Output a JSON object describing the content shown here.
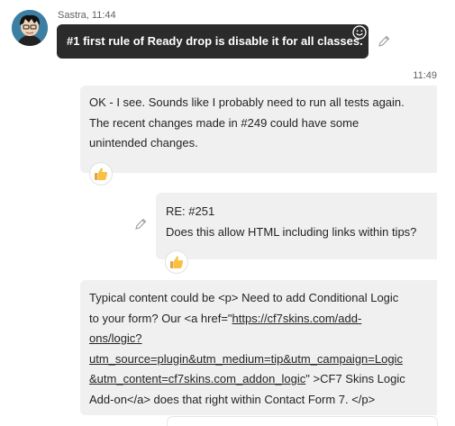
{
  "incoming": {
    "sender": "Sastra",
    "time": "11:44",
    "text": "#1 first rule of Ready drop is disable it for all classes."
  },
  "outgoing": {
    "time": "11:49",
    "messages": [
      {
        "lines": [
          "OK - I see. Sounds like I probably need to run all tests again.",
          "The recent changes made in #249 could have some",
          "unintended changes."
        ],
        "reaction": "thumbs-up"
      },
      {
        "lines": [
          "RE: #251",
          "Does this allow HTML including links within tips?"
        ],
        "reaction": "thumbs-up"
      },
      {
        "line1": "Typical content could be <p> Need to add Conditional Logic",
        "line2": "to your form? Our <a href=\"",
        "link1": "https://cf7skins.com/add-",
        "link2": "ons/logic?",
        "link3": "utm_source=plugin&utm_medium=tip&utm_campaign=Logic",
        "link4": "&utm_content=cf7skins.com_addon_logic",
        "line5_tail": "\" >CF7 Skins Logic",
        "line6": "Add-on</a> does that right within Contact Form 7. </p>"
      }
    ]
  }
}
